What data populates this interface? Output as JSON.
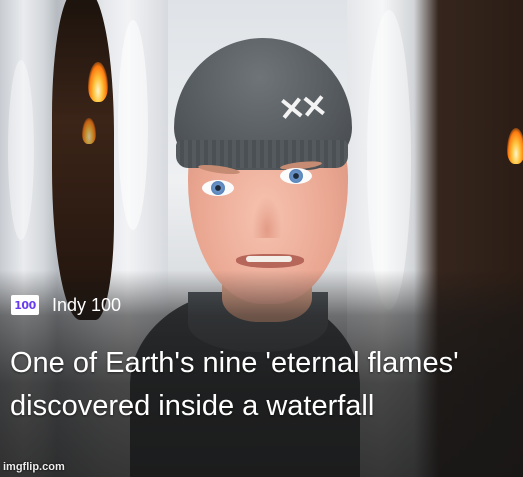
{
  "card": {
    "source": {
      "logo_text": "100",
      "name": "Indy 100"
    },
    "headline": "One of Earth's nine 'eternal flames' discovered inside a waterfall",
    "thumbnail": {
      "logo_icon": "under-armour-logo",
      "flame_color": "#ff8a1c",
      "snow_color": "#e9ebee"
    }
  },
  "watermark": "imgflip.com"
}
